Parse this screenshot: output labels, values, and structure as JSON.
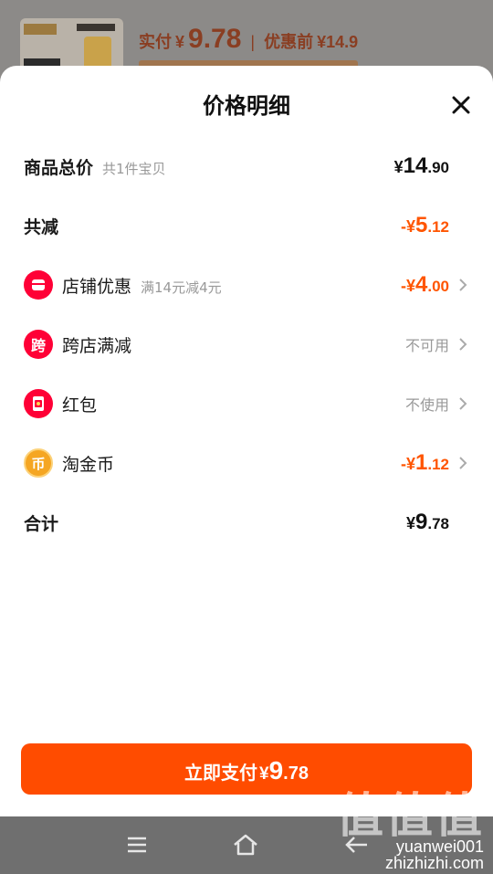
{
  "background": {
    "price_prefix": "实付",
    "price_symbol": "¥",
    "price_value": "9.78",
    "before_label": "优惠前",
    "before_value": "¥14.9"
  },
  "sheet": {
    "title": "价格明细",
    "rows": {
      "total": {
        "label": "商品总价",
        "sub": "共1件宝贝",
        "sym": "¥",
        "int": "14",
        "dec": ".90"
      },
      "reduction": {
        "label": "共减",
        "sym": "-¥",
        "int": "5",
        "dec": ".12"
      },
      "shop": {
        "label": "店铺优惠",
        "sub": "满14元减4元",
        "sym": "-¥",
        "int": "4",
        "dec": ".00"
      },
      "cross": {
        "label": "跨店满减",
        "icon_text": "跨",
        "status": "不可用"
      },
      "redpacket": {
        "label": "红包",
        "status": "不使用"
      },
      "coins": {
        "label": "淘金币",
        "icon_text": "币",
        "sym": "-¥",
        "int": "1",
        "dec": ".12"
      },
      "sum": {
        "label": "合计",
        "sym": "¥",
        "int": "9",
        "dec": ".78"
      }
    },
    "pay_button": {
      "label": "立即支付",
      "sym": "¥",
      "int": "9",
      "dec": ".78"
    }
  },
  "watermark": {
    "big": "值值值",
    "small": "yuanwei001",
    "site": "zhizhizhi.com"
  },
  "colors": {
    "accent": "#ff4c00",
    "discount": "#ff5500",
    "red_icon": "#ff0036",
    "coin": "#f5a623"
  },
  "icons": [
    "close-icon",
    "shop-icon",
    "cross-store-icon",
    "red-packet-icon",
    "coin-icon",
    "chevron-right-icon",
    "menu-icon",
    "home-icon",
    "back-icon"
  ]
}
